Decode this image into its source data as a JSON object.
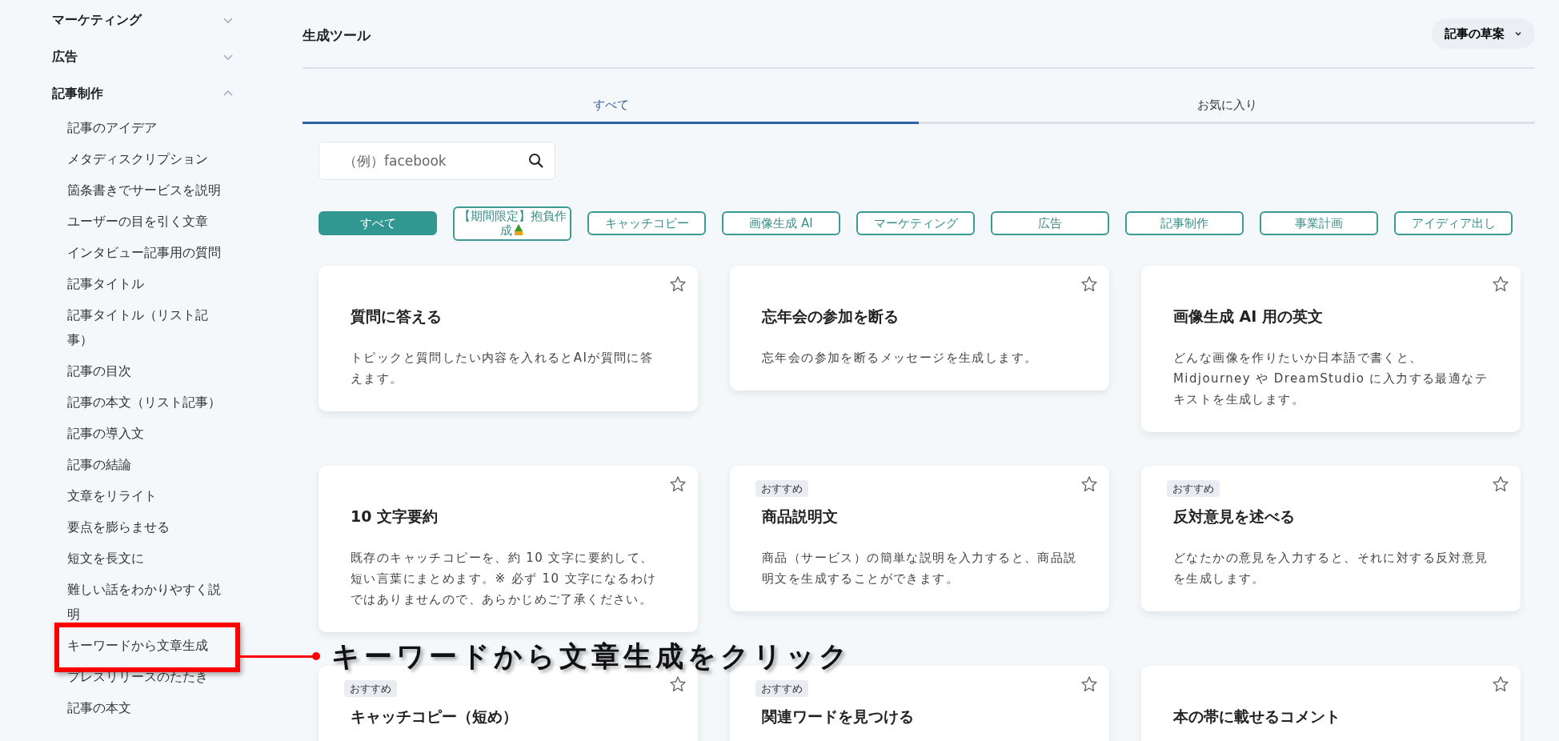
{
  "sidebar": {
    "sections": [
      {
        "label": "マーケティング",
        "expanded": false
      },
      {
        "label": "広告",
        "expanded": false
      },
      {
        "label": "記事制作",
        "expanded": true,
        "children": [
          {
            "label": "記事のアイデア",
            "callout": false
          },
          {
            "label": "メタディスクリプション",
            "callout": false
          },
          {
            "label": "箇条書きでサービスを説明",
            "callout": false
          },
          {
            "label": "ユーザーの目を引く文章",
            "callout": false
          },
          {
            "label": "インタビュー記事用の質問",
            "callout": false
          },
          {
            "label": "記事タイトル",
            "callout": false
          },
          {
            "label": "記事タイトル（リスト記事）",
            "callout": false
          },
          {
            "label": "記事の目次",
            "callout": false
          },
          {
            "label": "記事の本文（リスト記事）",
            "callout": false
          },
          {
            "label": "記事の導入文",
            "callout": false
          },
          {
            "label": "記事の結論",
            "callout": false
          },
          {
            "label": "文章をリライト",
            "callout": false
          },
          {
            "label": "要点を膨らませる",
            "callout": false
          },
          {
            "label": "短文を長文に",
            "callout": false
          },
          {
            "label": "難しい話をわかりやすく説明",
            "callout": false
          },
          {
            "label": "キーワードから文章生成",
            "callout": true
          },
          {
            "label": "プレスリリースのたたき",
            "callout": false
          },
          {
            "label": "記事の本文",
            "callout": false
          }
        ]
      }
    ]
  },
  "header": {
    "title": "生成ツール",
    "dropdown": "記事の草案"
  },
  "tabs": [
    {
      "label": "すべて",
      "selected": true
    },
    {
      "label": "お気に入り",
      "selected": false
    }
  ],
  "search": {
    "placeholder": "（例）facebook"
  },
  "filters": [
    {
      "label": "すべて",
      "selected": true,
      "has_icon": false
    },
    {
      "label": "【期間限定】抱負作成",
      "selected": false,
      "has_icon": true
    },
    {
      "label": "キャッチコピー",
      "selected": false,
      "has_icon": false
    },
    {
      "label": "画像生成 AI",
      "selected": false,
      "has_icon": false
    },
    {
      "label": "マーケティング",
      "selected": false,
      "has_icon": false
    },
    {
      "label": "広告",
      "selected": false,
      "has_icon": false
    },
    {
      "label": "記事制作",
      "selected": false,
      "has_icon": false
    },
    {
      "label": "事業計画",
      "selected": false,
      "has_icon": false
    },
    {
      "label": "アイディア出し",
      "selected": false,
      "has_icon": false
    }
  ],
  "cards": [
    {
      "title": "質問に答える",
      "description": "トピックと質問したい内容を入れるとAIが質問に答えます。",
      "favorite": false
    },
    {
      "title": "忘年会の参加を断る",
      "description": "忘年会の参加を断るメッセージを生成します。",
      "favorite": false
    },
    {
      "title": "画像生成 AI 用の英文",
      "description": "どんな画像を作りたいか日本語で書くと、Midjourney や DreamStudio に入力する最適なテキストを生成します。",
      "favorite": false
    },
    {
      "title": "10 文字要約",
      "description": "既存のキャッチコピーを、約 10 文字に要約して、短い言葉にまとめます。※ 必ず 10 文字になるわけではありませんので、あらかじめご了承ください。",
      "favorite": false
    },
    {
      "badge": "おすすめ",
      "title": "商品説明文",
      "description": "商品（サービス）の簡単な説明を入力すると、商品説明文を生成することができます。",
      "favorite": false
    },
    {
      "badge": "おすすめ",
      "title": "反対意見を述べる",
      "description": "どなたかの意見を入力すると、それに対する反対意見を生成します。",
      "favorite": false
    },
    {
      "badge": "おすすめ",
      "title": "キャッチコピー（短め）",
      "favorite": false
    },
    {
      "badge": "おすすめ",
      "title": "関連ワードを見つける",
      "favorite": false
    },
    {
      "title": "本の帯に載せるコメント",
      "favorite": false
    }
  ],
  "annotation": {
    "text": "キーワードから文章生成をクリック"
  }
}
